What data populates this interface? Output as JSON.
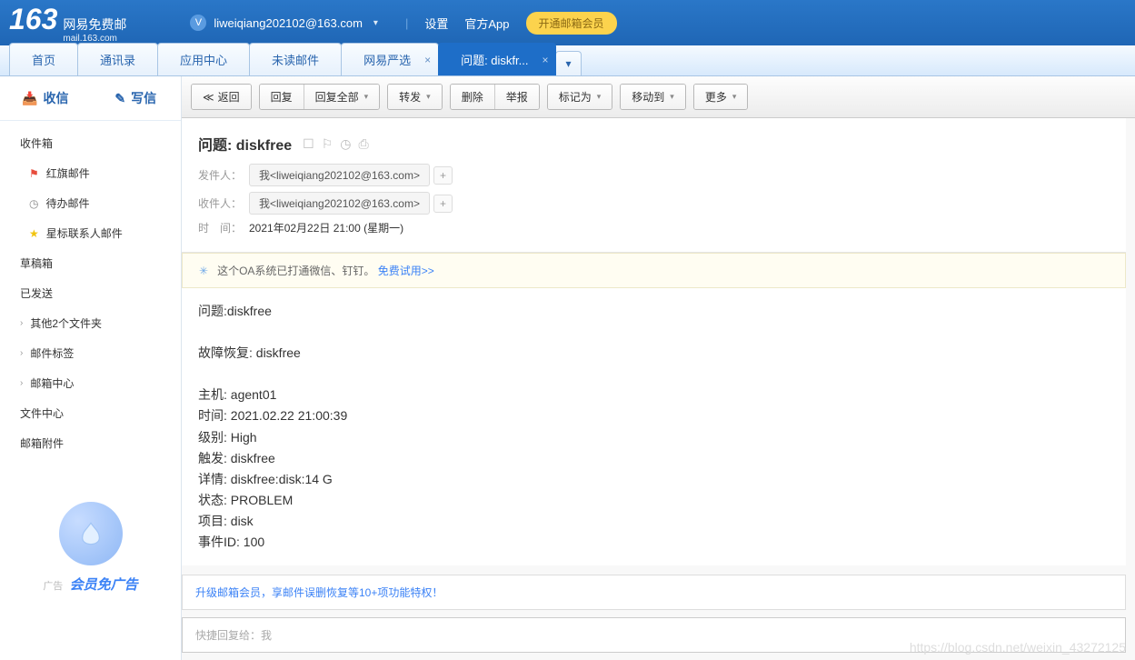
{
  "header": {
    "logo_num": "163",
    "logo_cn": "网易免费邮",
    "logo_en": "mail.163.com",
    "user_email": "liweiqiang202102@163.com",
    "settings": "设置",
    "official_app": "官方App",
    "vip_btn": "开通邮箱会员"
  },
  "tabs": [
    {
      "label": "首页",
      "closable": false,
      "active": false
    },
    {
      "label": "通讯录",
      "closable": false,
      "active": false
    },
    {
      "label": "应用中心",
      "closable": false,
      "active": false
    },
    {
      "label": "未读邮件",
      "closable": false,
      "active": false
    },
    {
      "label": "网易严选",
      "closable": true,
      "active": false
    },
    {
      "label": "问题: diskfr...",
      "closable": true,
      "active": true
    }
  ],
  "sidebar": {
    "receive": "收信",
    "compose": "写信",
    "folders": {
      "inbox": "收件箱",
      "flag": "红旗邮件",
      "pending": "待办邮件",
      "star": "星标联系人邮件",
      "drafts": "草稿箱",
      "sent": "已发送",
      "other": "其他2个文件夹",
      "tags": "邮件标签",
      "center": "邮箱中心",
      "filecenter": "文件中心",
      "attachments": "邮箱附件"
    },
    "ad_tag": "广告",
    "ad_text": "会员免广告"
  },
  "toolbar": {
    "back": "返回",
    "reply": "回复",
    "reply_all": "回复全部",
    "forward": "转发",
    "delete": "删除",
    "report": "举报",
    "mark": "标记为",
    "move": "移动到",
    "more": "更多"
  },
  "mail": {
    "subject": "问题: diskfree",
    "from_label": "发件人：",
    "from_value": "我<liweiqiang202102@163.com>",
    "to_label": "收件人：",
    "to_value": "我<liweiqiang202102@163.com>",
    "time_label": "时　间：",
    "time_value": "2021年02月22日 21:00 (星期一)"
  },
  "oa": {
    "text": "这个OA系统已打通微信、钉钉。",
    "link": "免费试用>>"
  },
  "body_lines": [
    "问题:diskfree",
    "",
    "故障恢复: diskfree",
    "",
    "主机: agent01",
    "时间: 2021.02.22 21:00:39",
    "级别: High",
    "触发: diskfree",
    "详情: diskfree:disk:14 G",
    "状态: PROBLEM",
    "项目: disk",
    "事件ID: 100"
  ],
  "upgrade_text": "升级邮箱会员，享邮件误删恢复等10+项功能特权！",
  "quick_reply_prefix": "快捷回复给：",
  "quick_reply_to": "我",
  "watermark": "https://blog.csdn.net/weixin_43272125"
}
